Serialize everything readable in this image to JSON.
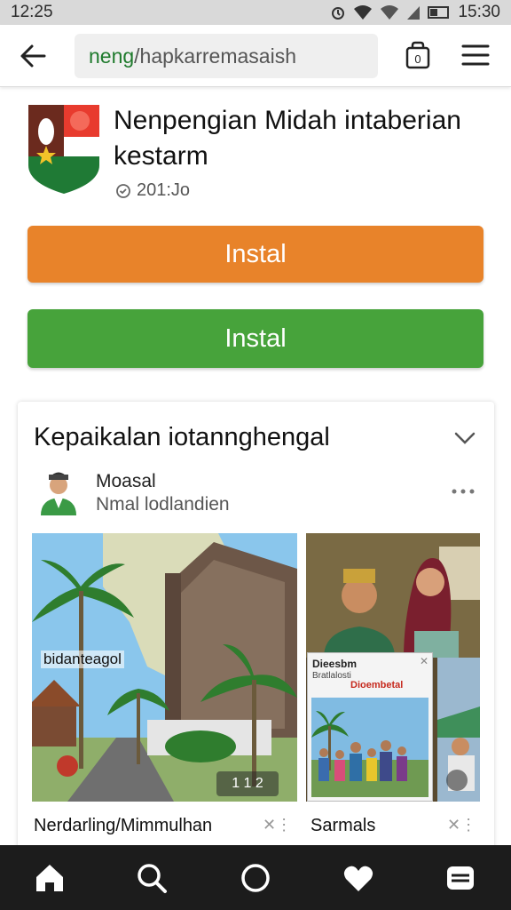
{
  "status_bar": {
    "time": "12:25",
    "clock": "15:30"
  },
  "url_bar": {
    "domain": "neng",
    "path": "/hapkarremasaish",
    "tab_count": "0"
  },
  "app": {
    "title": "Nenpengian Midah intaberian kestarm",
    "meta": "201:Jo",
    "colors": {
      "orange": "#e8832a",
      "green": "#47a33b"
    }
  },
  "buttons": {
    "install_primary": "Instal",
    "install_secondary": "Instal"
  },
  "feed": {
    "title": "Kepaikalan iotannghengal",
    "author": {
      "name": "Moasal",
      "subtitle": "Nmal lodlandien"
    },
    "left_post": {
      "caption": "bidanteagol",
      "badge": "1 1 2",
      "label": "Nerdarling/Mimmulhan"
    },
    "right_post": {
      "card_title": "Dieesbm",
      "card_sub": "Bratlalosti",
      "card_red": "Dioembetal",
      "label": "Sarmals"
    }
  },
  "nav": [
    "home-icon",
    "search-icon",
    "circle-icon",
    "heart-icon",
    "menu-box-icon"
  ]
}
